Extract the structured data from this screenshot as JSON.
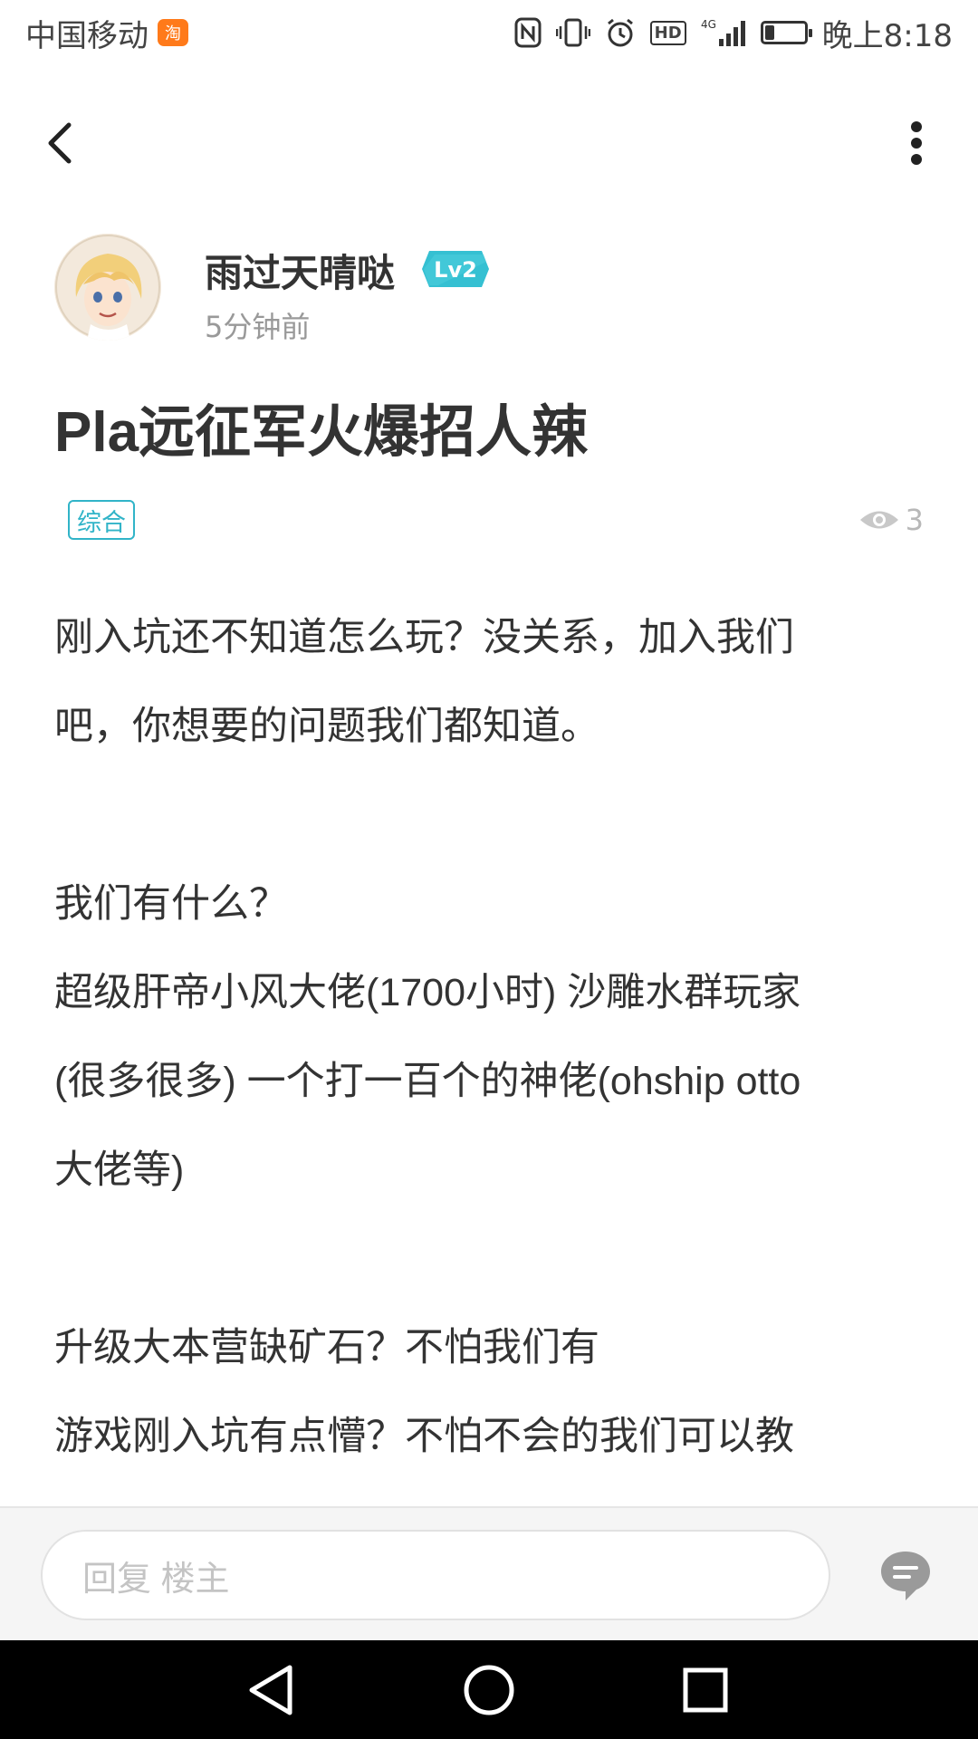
{
  "status_bar": {
    "carrier": "中国移动",
    "taobao_icon_text": "淘",
    "network": "4G",
    "hd": "HD",
    "battery_level_percent": 25,
    "time": "晚上8:18"
  },
  "post": {
    "author_name": "雨过天晴哒",
    "level": "Lv2",
    "time_ago": "5分钟前",
    "title": "Pla远征军火爆招人辣",
    "tag": "综合",
    "views": "3",
    "body_lines": [
      "刚入坑还不知道怎么玩？没关系，加入我们",
      "吧，你想要的问题我们都知道。",
      "",
      "我们有什么？",
      "超级肝帝小风大佬(1700小时)   沙雕水群玩家",
      "(很多很多)   一个打一百个的神佬(ohship otto",
      "大佬等)",
      "",
      "升级大本营缺矿石？不怕我们有",
      "游戏刚入坑有点懵？不怕不会的我们可以教"
    ]
  },
  "reply": {
    "placeholder": "回复  楼主"
  },
  "colors": {
    "accent": "#31b4c8",
    "muted": "#999999",
    "text": "#333333"
  }
}
